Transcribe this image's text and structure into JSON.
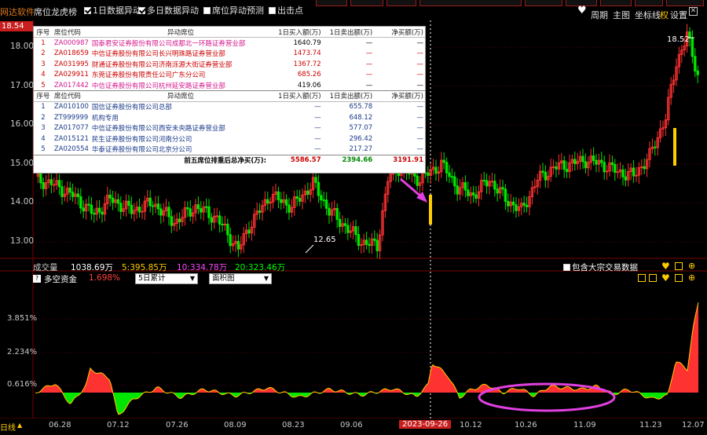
{
  "app": {
    "brand": "网达软件",
    "window_title": "席位龙虎榜"
  },
  "toolbar": {
    "options": [
      {
        "label": "1日数据异动",
        "checked": true
      },
      {
        "label": "多日数据异动",
        "checked": true
      },
      {
        "label": "席位异动预测",
        "checked": false
      },
      {
        "label": "出击点",
        "checked": false
      }
    ],
    "right_items": [
      "周期",
      "主图",
      "坐标线",
      "权",
      "设置"
    ]
  },
  "price_axis": {
    "current_price_tag": "18.54",
    "labels": [
      "18.00",
      "17.00",
      "16.00",
      "15.00",
      "14.00",
      "13.00"
    ],
    "low_label": "12.65",
    "high_label": "18.52"
  },
  "seat_popup": {
    "buy_headers": [
      "序号",
      "席位代码",
      "异动席位",
      "1日买入额(万)",
      "1日卖出额(万)",
      "净买额(万)"
    ],
    "buy_rows": [
      {
        "no": "1",
        "code": "ZA000987",
        "name": "国泰君安证券股份有限公司成都北一环路证券营业部",
        "buy": "1640.79",
        "sell": "—",
        "net": "—"
      },
      {
        "no": "2",
        "code": "ZA018659",
        "name": "中信证券股份有限公司长兴明珠路证券营业部",
        "buy": "1473.74",
        "sell": "—",
        "net": "—"
      },
      {
        "no": "3",
        "code": "ZA031995",
        "name": "财通证券股份有限公司济南泺源大街证券营业部",
        "buy": "1367.72",
        "sell": "—",
        "net": "—"
      },
      {
        "no": "4",
        "code": "ZA029911",
        "name": "东莞证券股份有限责任公司广东分公司",
        "buy": "685.26",
        "sell": "—",
        "net": "—"
      },
      {
        "no": "5",
        "code": "ZA017442",
        "name": "中信证券股份有限公司杭州延安路证券营业部",
        "buy": "419.06",
        "sell": "—",
        "net": "—"
      }
    ],
    "sell_headers": [
      "序号",
      "席位代码",
      "异动席位",
      "1日买入额(万)",
      "1日卖出额(万)",
      "净买额(万)"
    ],
    "sell_rows": [
      {
        "no": "1",
        "code": "ZA010100",
        "name": "国信证券股份有限公司总部",
        "buy": "—",
        "sell": "655.78",
        "net": "—"
      },
      {
        "no": "2",
        "code": "ZT999999",
        "name": "机构专用",
        "buy": "—",
        "sell": "648.12",
        "net": "—"
      },
      {
        "no": "3",
        "code": "ZA017077",
        "name": "中信证券股份有限公司西安未央路证券营业部",
        "buy": "—",
        "sell": "577.07",
        "net": "—"
      },
      {
        "no": "4",
        "code": "ZA015121",
        "name": "民生证券股份有限公司河南分公司",
        "buy": "—",
        "sell": "296.42",
        "net": "—"
      },
      {
        "no": "5",
        "code": "ZA020554",
        "name": "华泰证券股份有限公司北京分公司",
        "buy": "—",
        "sell": "217.27",
        "net": "—"
      }
    ],
    "total": {
      "label": "前五席位排重后总净买(万):",
      "buy": "5586.57",
      "sell": "2394.66",
      "net": "3191.91"
    }
  },
  "volume_bar": {
    "label": "成交量",
    "value": "1038.69万",
    "ma5": "5:395.85万",
    "ma10": "10:334.78万",
    "ma20": "20:323.46万",
    "include_block_trade": "包含大宗交易数据"
  },
  "indicator": {
    "name": "多空资金",
    "value": "1.698%",
    "period_select": "5日累计",
    "type_select": "面积图",
    "axis_labels": [
      "3.851%",
      "2.234%",
      "0.616%"
    ]
  },
  "date_axis": {
    "period": "日线",
    "labels": [
      "06.28",
      "07.12",
      "07.26",
      "08.09",
      "08.23",
      "09.06",
      "2023-09-26",
      "10.12",
      "10.26",
      "11.09",
      "11.23",
      "12.07"
    ]
  },
  "colors": {
    "up": "#ff3232",
    "down": "#00e600",
    "highlight_candle": "#ffcc00",
    "annotation": "#e040e0",
    "accent": "#e07a1a"
  },
  "chart_data": {
    "type": "candlestick",
    "y_axis_range": [
      12.5,
      18.8
    ],
    "low": 12.65,
    "high": 18.52,
    "last_price": 18.54,
    "indicator_series": {
      "name": "多空资金",
      "unit": "%",
      "ticks": [
        0.616,
        2.234,
        3.851
      ],
      "last": 1.698
    }
  }
}
